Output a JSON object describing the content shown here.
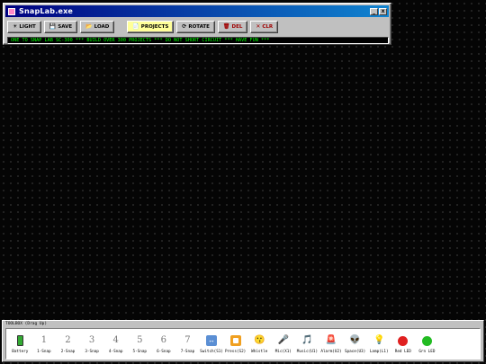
{
  "window": {
    "title": "SnapLab.exe",
    "minimize_glyph": "_",
    "close_glyph": "x"
  },
  "toolbar": {
    "buttons": [
      {
        "icon": "☀",
        "label": "LIGHT"
      },
      {
        "icon": "💾",
        "label": "SAVE"
      },
      {
        "icon": "📂",
        "label": "LOAD"
      },
      {
        "icon": "📄",
        "label": "PROJECTS"
      },
      {
        "icon": "⟳",
        "label": "ROTATE"
      },
      {
        "icon": "🗑",
        "label": "DEL"
      },
      {
        "icon": "✕",
        "label": "CLR"
      }
    ]
  },
  "marquee": {
    "text": "ONE TO SNAP LAB SC-300 *** BUILD OVER 300 PROJECTS *** DO NOT SHORT CIRCUIT *** HAVE FUN ***"
  },
  "toolbox": {
    "title": "TOOLBOX (Drag Up)",
    "items": [
      {
        "icon": "battery-icon",
        "glyph": "",
        "label": "Battery"
      },
      {
        "icon": "number-1-icon",
        "glyph": "1",
        "label": "1-Snap"
      },
      {
        "icon": "number-2-icon",
        "glyph": "2",
        "label": "2-Snap"
      },
      {
        "icon": "number-3-icon",
        "glyph": "3",
        "label": "3-Snap"
      },
      {
        "icon": "number-4-icon",
        "glyph": "4",
        "label": "4-Snap"
      },
      {
        "icon": "number-5-icon",
        "glyph": "5",
        "label": "5-Snap"
      },
      {
        "icon": "number-6-icon",
        "glyph": "6",
        "label": "6-Snap"
      },
      {
        "icon": "number-7-icon",
        "glyph": "7",
        "label": "7-Snap"
      },
      {
        "icon": "switch-icon",
        "glyph": "↔",
        "label": "Switch(S1)"
      },
      {
        "icon": "press-icon",
        "glyph": "",
        "label": "Press(S2)"
      },
      {
        "icon": "whistle-icon",
        "glyph": "😗",
        "label": "Whistle"
      },
      {
        "icon": "microphone-icon",
        "glyph": "🎤",
        "label": "Mic(X1)"
      },
      {
        "icon": "music-icon",
        "glyph": "🎵",
        "label": "Music(U1)"
      },
      {
        "icon": "alarm-icon",
        "glyph": "🚨",
        "label": "Alarm(U2)"
      },
      {
        "icon": "alien-icon",
        "glyph": "👽",
        "label": "Space(U3)"
      },
      {
        "icon": "lamp-icon",
        "glyph": "💡",
        "label": "Lamp(L1)"
      },
      {
        "icon": "red-led-icon",
        "glyph": "",
        "label": "Red LED",
        "color": "#e02020"
      },
      {
        "icon": "green-led-icon",
        "glyph": "",
        "label": "Grn LED",
        "color": "#22bb22"
      }
    ]
  }
}
